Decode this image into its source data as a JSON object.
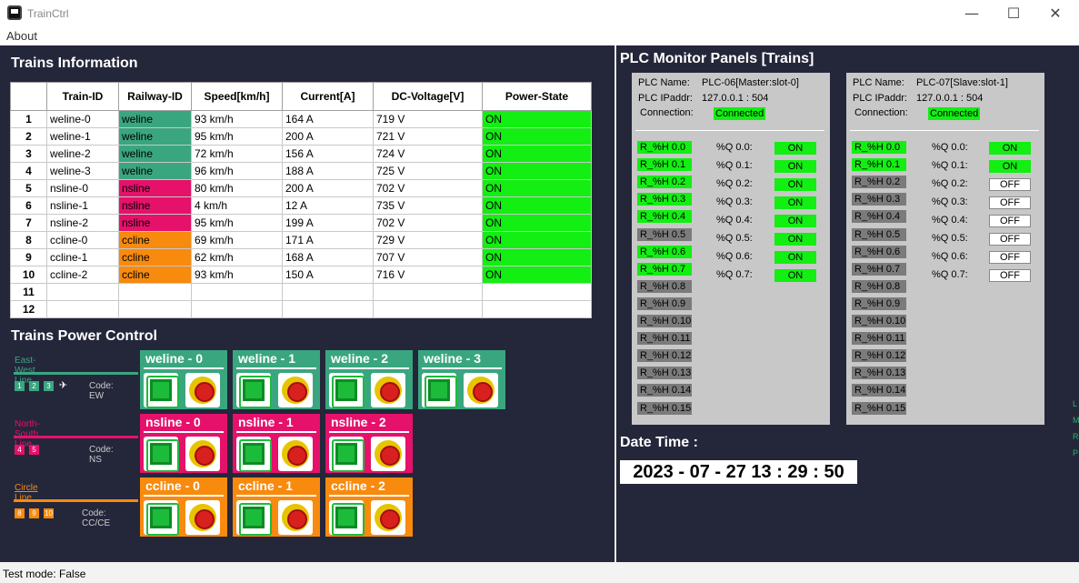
{
  "window": {
    "title": "TrainCtrl",
    "minimize": "—",
    "maximize": "☐",
    "close": "✕"
  },
  "menu": {
    "about": "About"
  },
  "trains_info": {
    "title": "Trains Information",
    "columns": [
      "",
      "Train-ID",
      "Railway-ID",
      "Speed[km/h]",
      "Current[A]",
      "DC-Voltage[V]",
      "Power-State"
    ],
    "rows": [
      {
        "n": "1",
        "train": "weline-0",
        "railway": "weline",
        "speed": "93 km/h",
        "current": "164 A",
        "voltage": "719 V",
        "power": "ON"
      },
      {
        "n": "2",
        "train": "weline-1",
        "railway": "weline",
        "speed": "95 km/h",
        "current": "200 A",
        "voltage": "721 V",
        "power": "ON"
      },
      {
        "n": "3",
        "train": "weline-2",
        "railway": "weline",
        "speed": "72 km/h",
        "current": "156 A",
        "voltage": "724 V",
        "power": "ON"
      },
      {
        "n": "4",
        "train": "weline-3",
        "railway": "weline",
        "speed": "96 km/h",
        "current": "188 A",
        "voltage": "725 V",
        "power": "ON"
      },
      {
        "n": "5",
        "train": "nsline-0",
        "railway": "nsline",
        "speed": "80 km/h",
        "current": "200 A",
        "voltage": "702 V",
        "power": "ON"
      },
      {
        "n": "6",
        "train": "nsline-1",
        "railway": "nsline",
        "speed": "4 km/h",
        "current": "12 A",
        "voltage": "735 V",
        "power": "ON"
      },
      {
        "n": "7",
        "train": "nsline-2",
        "railway": "nsline",
        "speed": "95 km/h",
        "current": "199 A",
        "voltage": "702 V",
        "power": "ON"
      },
      {
        "n": "8",
        "train": "ccline-0",
        "railway": "ccline",
        "speed": "69 km/h",
        "current": "171 A",
        "voltage": "729 V",
        "power": "ON"
      },
      {
        "n": "9",
        "train": "ccline-1",
        "railway": "ccline",
        "speed": "62 km/h",
        "current": "168 A",
        "voltage": "707 V",
        "power": "ON"
      },
      {
        "n": "10",
        "train": "ccline-2",
        "railway": "ccline",
        "speed": "93 km/h",
        "current": "150 A",
        "voltage": "716 V",
        "power": "ON"
      },
      {
        "n": "11",
        "train": "",
        "railway": "",
        "speed": "",
        "current": "",
        "voltage": "",
        "power": ""
      },
      {
        "n": "12",
        "train": "",
        "railway": "",
        "speed": "",
        "current": "",
        "voltage": "",
        "power": ""
      }
    ],
    "railway_colors": {
      "weline": "#3aa680",
      "nsline": "#e5116a",
      "ccline": "#f88a0e"
    },
    "on_color": "#13ee13"
  },
  "power_control": {
    "title": "Trains Power Control",
    "lines": [
      {
        "name": "East-West Line",
        "color": "#3aa680",
        "badges": [
          "1",
          "2",
          "3",
          "✈"
        ],
        "code": "Code: EW",
        "trains": [
          "weline - 0",
          "weline - 1",
          "weline - 2",
          "weline - 3"
        ]
      },
      {
        "name": "North-South Line",
        "color": "#e5116a",
        "badges": [
          "4",
          "5"
        ],
        "code": "Code: NS",
        "trains": [
          "nsline - 0",
          "nsline - 1",
          "nsline - 2"
        ]
      },
      {
        "name": "Circle Line",
        "color": "#f88a0e",
        "badges": [
          "8",
          "9",
          "10"
        ],
        "code": "Code: CC/CE",
        "trains": [
          "ccline - 0",
          "ccline - 1",
          "ccline - 2"
        ]
      }
    ]
  },
  "plc": {
    "title": "PLC Monitor Panels [Trains]",
    "panels": [
      {
        "name_label": "PLC Name:",
        "name": "PLC-06[Master:slot-0]",
        "ip_label": "PLC IPaddr:",
        "ip": "127.0.0.1 : 504",
        "conn_label": "Connection:",
        "conn": "Connected",
        "registers": [
          {
            "label": "R_%H 0.0",
            "on": true
          },
          {
            "label": "R_%H 0.1",
            "on": true
          },
          {
            "label": "R_%H 0.2",
            "on": true
          },
          {
            "label": "R_%H 0.3",
            "on": true
          },
          {
            "label": "R_%H 0.4",
            "on": true
          },
          {
            "label": "R_%H 0.5",
            "on": false
          },
          {
            "label": "R_%H 0.6",
            "on": true
          },
          {
            "label": "R_%H 0.7",
            "on": true
          },
          {
            "label": "R_%H 0.8",
            "on": false
          },
          {
            "label": "R_%H 0.9",
            "on": false
          },
          {
            "label": "R_%H 0.10",
            "on": false
          },
          {
            "label": "R_%H 0.11",
            "on": false
          },
          {
            "label": "R_%H 0.12",
            "on": false
          },
          {
            "label": "R_%H 0.13",
            "on": false
          },
          {
            "label": "R_%H 0.14",
            "on": false
          },
          {
            "label": "R_%H 0.15",
            "on": false
          }
        ],
        "coils": [
          {
            "label": "%Q 0.0:",
            "value": "ON"
          },
          {
            "label": "%Q 0.1:",
            "value": "ON"
          },
          {
            "label": "%Q 0.2:",
            "value": "ON"
          },
          {
            "label": "%Q 0.3:",
            "value": "ON"
          },
          {
            "label": "%Q 0.4:",
            "value": "ON"
          },
          {
            "label": "%Q 0.5:",
            "value": "ON"
          },
          {
            "label": "%Q 0.6:",
            "value": "ON"
          },
          {
            "label": "%Q 0.7:",
            "value": "ON"
          }
        ]
      },
      {
        "name_label": "PLC Name:",
        "name": "PLC-07[Slave:slot-1]",
        "ip_label": "PLC IPaddr:",
        "ip": "127.0.0.1 : 504",
        "conn_label": "Connection:",
        "conn": "Connected",
        "registers": [
          {
            "label": "R_%H 0.0",
            "on": true
          },
          {
            "label": "R_%H 0.1",
            "on": true
          },
          {
            "label": "R_%H 0.2",
            "on": false
          },
          {
            "label": "R_%H 0.3",
            "on": false
          },
          {
            "label": "R_%H 0.4",
            "on": false
          },
          {
            "label": "R_%H 0.5",
            "on": false
          },
          {
            "label": "R_%H 0.6",
            "on": false
          },
          {
            "label": "R_%H 0.7",
            "on": false
          },
          {
            "label": "R_%H 0.8",
            "on": false
          },
          {
            "label": "R_%H 0.9",
            "on": false
          },
          {
            "label": "R_%H 0.10",
            "on": false
          },
          {
            "label": "R_%H 0.11",
            "on": false
          },
          {
            "label": "R_%H 0.12",
            "on": false
          },
          {
            "label": "R_%H 0.13",
            "on": false
          },
          {
            "label": "R_%H 0.14",
            "on": false
          },
          {
            "label": "R_%H 0.15",
            "on": false
          }
        ],
        "coils": [
          {
            "label": "%Q 0.0:",
            "value": "ON"
          },
          {
            "label": "%Q 0.1:",
            "value": "ON"
          },
          {
            "label": "%Q 0.2:",
            "value": "OFF"
          },
          {
            "label": "%Q 0.3:",
            "value": "OFF"
          },
          {
            "label": "%Q 0.4:",
            "value": "OFF"
          },
          {
            "label": "%Q 0.5:",
            "value": "OFF"
          },
          {
            "label": "%Q 0.6:",
            "value": "OFF"
          },
          {
            "label": "%Q 0.7:",
            "value": "OFF"
          }
        ]
      }
    ]
  },
  "datetime": {
    "label": "Date  Time :",
    "value": "2023 - 07 - 27 13 : 29 : 50"
  },
  "side_letters": [
    "L",
    "M",
    "R",
    "P"
  ],
  "status": {
    "text": "Test mode: False"
  }
}
